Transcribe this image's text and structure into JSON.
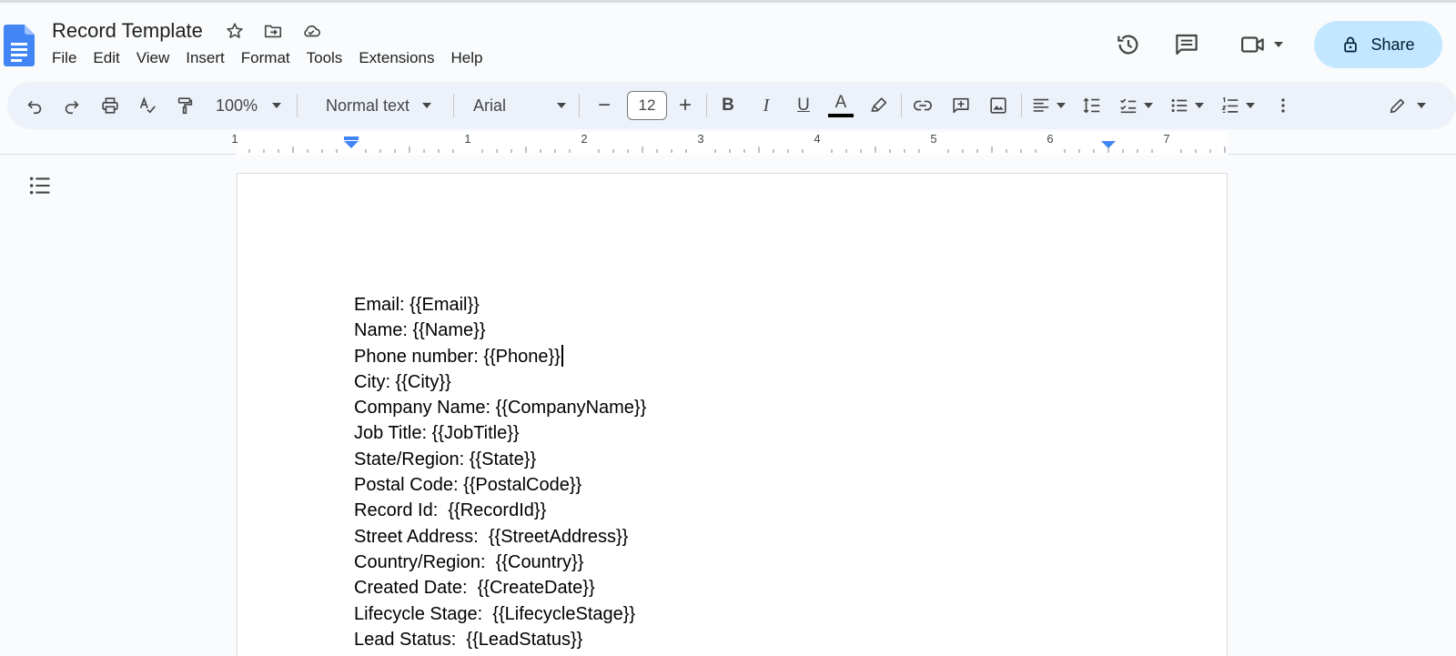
{
  "document": {
    "title": "Record Template"
  },
  "menu": {
    "items": [
      "File",
      "Edit",
      "View",
      "Insert",
      "Format",
      "Tools",
      "Extensions",
      "Help"
    ]
  },
  "header": {
    "share_label": "Share",
    "icons": [
      "star-icon",
      "move-to-folder-icon",
      "cloud-saved-icon",
      "version-history-icon",
      "comments-icon",
      "meet-icon",
      "lock-icon"
    ]
  },
  "toolbar": {
    "zoom": "100%",
    "paragraph_style": "Normal text",
    "font": "Arial",
    "font_size": "12",
    "decrease_label": "−",
    "increase_label": "+",
    "bold_label": "B",
    "italic_label": "I",
    "underline_label": "U",
    "text_color_label": "A",
    "text_color": "#000000"
  },
  "ruler": {
    "labels": [
      "1",
      "1",
      "2",
      "3",
      "4",
      "5",
      "6",
      "7"
    ],
    "marker_color": "#4285f4"
  },
  "page": {
    "lines": [
      "Email: {{Email}}",
      "Name: {{Name}}",
      "Phone number: {{Phone}}",
      "City: {{City}}",
      "Company Name: {{CompanyName}}",
      "Job Title: {{JobTitle}}",
      "State/Region: {{State}}",
      "Postal Code: {{PostalCode}}",
      "Record Id:  {{RecordId}}",
      "Street Address:  {{StreetAddress}}",
      "Country/Region:  {{Country}}",
      "Created Date:  {{CreateDate}}",
      "Lifecycle Stage:  {{LifecycleStage}}",
      "Lead Status:  {{LeadStatus}}"
    ]
  },
  "colors": {
    "share_bg": "#c2e7ff",
    "toolbar_bg": "#edf2fa",
    "docs_blue": "#4285f4"
  }
}
